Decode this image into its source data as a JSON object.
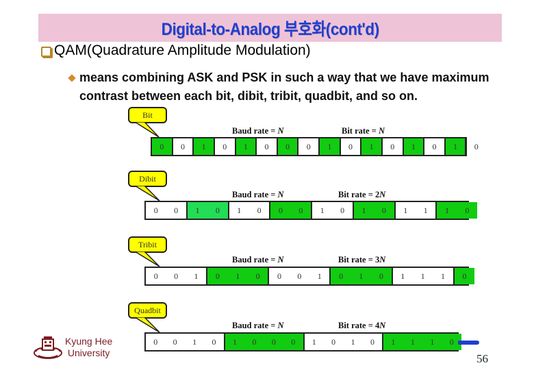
{
  "slide": {
    "title": "Digital-to-Analog 부호화(cont'd)",
    "heading": "QAM(Quadrature Amplitude Modulation)",
    "bullet_text": "means combining ASK and PSK in such a way that we have maximum contrast between each bit, dibit, tribit, quadbit, and so on.",
    "page_number": "56",
    "footer": {
      "line1": "Kyung Hee",
      "line2": "University"
    },
    "colors": {
      "title_bg": "#efc3d7",
      "title_text": "#1f3fcf",
      "cell_green": "#11cc11",
      "callout": "#ffff00",
      "university": "#7a1c24"
    }
  },
  "rows": [
    {
      "label": "Bit",
      "baud_label": "Baud rate = ",
      "baud_var": "N",
      "bit_label": "Bit rate = ",
      "bit_var": "N",
      "groups": [
        [
          "0"
        ],
        [
          "0"
        ],
        [
          "1"
        ],
        [
          "0"
        ],
        [
          "1"
        ],
        [
          "0"
        ],
        [
          "0"
        ],
        [
          "0"
        ],
        [
          "1"
        ],
        [
          "0"
        ],
        [
          "1"
        ],
        [
          "0"
        ],
        [
          "1"
        ],
        [
          "0"
        ],
        [
          "1"
        ],
        [
          "0"
        ]
      ],
      "first_green": true,
      "open_right": false
    },
    {
      "label": "Dibit",
      "baud_label": "Baud rate = ",
      "baud_var": "N",
      "bit_label": "Bit rate = 2",
      "bit_var": "N",
      "groups": [
        [
          "0",
          "0"
        ],
        [
          "1",
          "0"
        ],
        [
          "1",
          "0"
        ],
        [
          "0",
          "0"
        ],
        [
          "1",
          "0"
        ],
        [
          "1",
          "0"
        ],
        [
          "1",
          "1"
        ],
        [
          "1",
          "0"
        ]
      ],
      "first_green": false,
      "open_right": false
    },
    {
      "label": "Tribit",
      "baud_label": "Baud rate = ",
      "baud_var": "N",
      "bit_label": "Bit rate = 3",
      "bit_var": "N",
      "groups": [
        [
          "0",
          "0",
          "1"
        ],
        [
          "0",
          "1",
          "0"
        ],
        [
          "0",
          "0",
          "1"
        ],
        [
          "0",
          "1",
          "0"
        ],
        [
          "1",
          "1",
          "1"
        ],
        [
          "0"
        ]
      ],
      "first_green": false,
      "open_right": true
    },
    {
      "label": "Quadbit",
      "baud_label": "Baud rate = ",
      "baud_var": "N",
      "bit_label": "Bit rate = 4",
      "bit_var": "N",
      "groups": [
        [
          "0",
          "0",
          "1",
          "0"
        ],
        [
          "1",
          "0",
          "0",
          "0"
        ],
        [
          "1",
          "0",
          "1",
          "0"
        ],
        [
          "1",
          "1",
          "1",
          "0"
        ]
      ],
      "first_green": false,
      "open_right": false
    }
  ]
}
